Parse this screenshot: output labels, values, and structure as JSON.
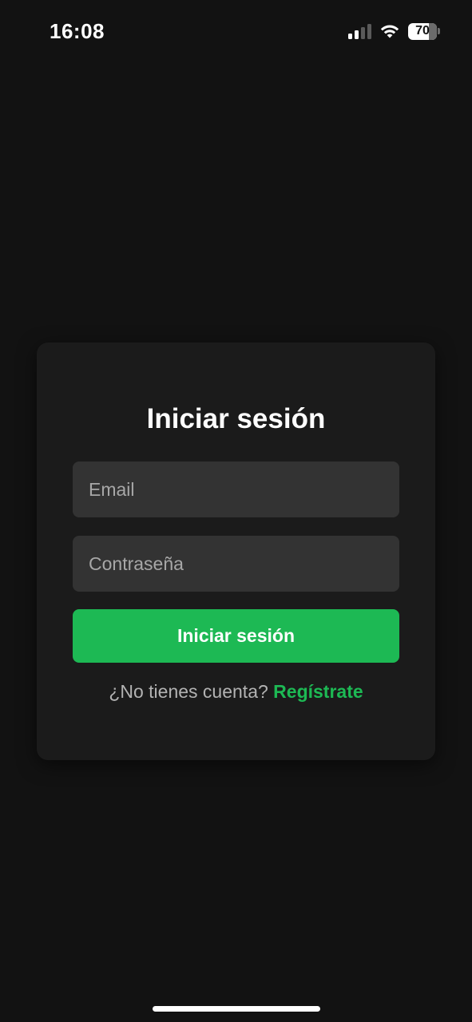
{
  "status_bar": {
    "time": "16:08",
    "battery_level": "70",
    "icons": [
      "cellular-signal-icon",
      "wifi-icon",
      "battery-icon"
    ]
  },
  "login": {
    "title": "Iniciar sesión",
    "email_placeholder": "Email",
    "email_value": "",
    "password_placeholder": "Contraseña",
    "password_value": "",
    "submit_label": "Iniciar sesión",
    "signup_prompt": "¿No tienes cuenta?",
    "signup_link": "Regístrate"
  },
  "colors": {
    "background": "#121212",
    "card": "#1b1b1b",
    "input": "#333333",
    "accent": "#1db954",
    "text": "#ffffff",
    "muted_text": "#b3b3b3"
  }
}
